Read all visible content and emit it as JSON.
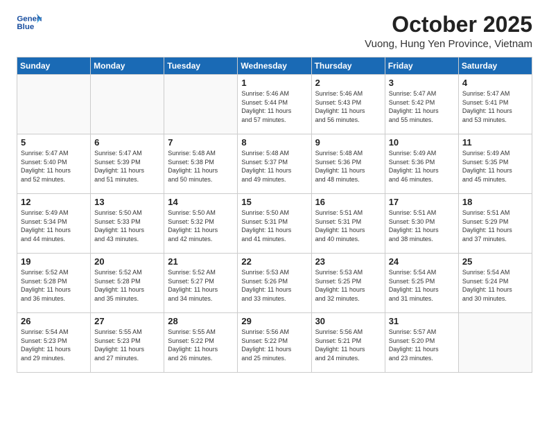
{
  "header": {
    "logo_line1": "General",
    "logo_line2": "Blue",
    "month_title": "October 2025",
    "subtitle": "Vuong, Hung Yen Province, Vietnam"
  },
  "weekdays": [
    "Sunday",
    "Monday",
    "Tuesday",
    "Wednesday",
    "Thursday",
    "Friday",
    "Saturday"
  ],
  "weeks": [
    [
      {
        "day": "",
        "info": ""
      },
      {
        "day": "",
        "info": ""
      },
      {
        "day": "",
        "info": ""
      },
      {
        "day": "1",
        "info": "Sunrise: 5:46 AM\nSunset: 5:44 PM\nDaylight: 11 hours\nand 57 minutes."
      },
      {
        "day": "2",
        "info": "Sunrise: 5:46 AM\nSunset: 5:43 PM\nDaylight: 11 hours\nand 56 minutes."
      },
      {
        "day": "3",
        "info": "Sunrise: 5:47 AM\nSunset: 5:42 PM\nDaylight: 11 hours\nand 55 minutes."
      },
      {
        "day": "4",
        "info": "Sunrise: 5:47 AM\nSunset: 5:41 PM\nDaylight: 11 hours\nand 53 minutes."
      }
    ],
    [
      {
        "day": "5",
        "info": "Sunrise: 5:47 AM\nSunset: 5:40 PM\nDaylight: 11 hours\nand 52 minutes."
      },
      {
        "day": "6",
        "info": "Sunrise: 5:47 AM\nSunset: 5:39 PM\nDaylight: 11 hours\nand 51 minutes."
      },
      {
        "day": "7",
        "info": "Sunrise: 5:48 AM\nSunset: 5:38 PM\nDaylight: 11 hours\nand 50 minutes."
      },
      {
        "day": "8",
        "info": "Sunrise: 5:48 AM\nSunset: 5:37 PM\nDaylight: 11 hours\nand 49 minutes."
      },
      {
        "day": "9",
        "info": "Sunrise: 5:48 AM\nSunset: 5:36 PM\nDaylight: 11 hours\nand 48 minutes."
      },
      {
        "day": "10",
        "info": "Sunrise: 5:49 AM\nSunset: 5:36 PM\nDaylight: 11 hours\nand 46 minutes."
      },
      {
        "day": "11",
        "info": "Sunrise: 5:49 AM\nSunset: 5:35 PM\nDaylight: 11 hours\nand 45 minutes."
      }
    ],
    [
      {
        "day": "12",
        "info": "Sunrise: 5:49 AM\nSunset: 5:34 PM\nDaylight: 11 hours\nand 44 minutes."
      },
      {
        "day": "13",
        "info": "Sunrise: 5:50 AM\nSunset: 5:33 PM\nDaylight: 11 hours\nand 43 minutes."
      },
      {
        "day": "14",
        "info": "Sunrise: 5:50 AM\nSunset: 5:32 PM\nDaylight: 11 hours\nand 42 minutes."
      },
      {
        "day": "15",
        "info": "Sunrise: 5:50 AM\nSunset: 5:31 PM\nDaylight: 11 hours\nand 41 minutes."
      },
      {
        "day": "16",
        "info": "Sunrise: 5:51 AM\nSunset: 5:31 PM\nDaylight: 11 hours\nand 40 minutes."
      },
      {
        "day": "17",
        "info": "Sunrise: 5:51 AM\nSunset: 5:30 PM\nDaylight: 11 hours\nand 38 minutes."
      },
      {
        "day": "18",
        "info": "Sunrise: 5:51 AM\nSunset: 5:29 PM\nDaylight: 11 hours\nand 37 minutes."
      }
    ],
    [
      {
        "day": "19",
        "info": "Sunrise: 5:52 AM\nSunset: 5:28 PM\nDaylight: 11 hours\nand 36 minutes."
      },
      {
        "day": "20",
        "info": "Sunrise: 5:52 AM\nSunset: 5:28 PM\nDaylight: 11 hours\nand 35 minutes."
      },
      {
        "day": "21",
        "info": "Sunrise: 5:52 AM\nSunset: 5:27 PM\nDaylight: 11 hours\nand 34 minutes."
      },
      {
        "day": "22",
        "info": "Sunrise: 5:53 AM\nSunset: 5:26 PM\nDaylight: 11 hours\nand 33 minutes."
      },
      {
        "day": "23",
        "info": "Sunrise: 5:53 AM\nSunset: 5:25 PM\nDaylight: 11 hours\nand 32 minutes."
      },
      {
        "day": "24",
        "info": "Sunrise: 5:54 AM\nSunset: 5:25 PM\nDaylight: 11 hours\nand 31 minutes."
      },
      {
        "day": "25",
        "info": "Sunrise: 5:54 AM\nSunset: 5:24 PM\nDaylight: 11 hours\nand 30 minutes."
      }
    ],
    [
      {
        "day": "26",
        "info": "Sunrise: 5:54 AM\nSunset: 5:23 PM\nDaylight: 11 hours\nand 29 minutes."
      },
      {
        "day": "27",
        "info": "Sunrise: 5:55 AM\nSunset: 5:23 PM\nDaylight: 11 hours\nand 27 minutes."
      },
      {
        "day": "28",
        "info": "Sunrise: 5:55 AM\nSunset: 5:22 PM\nDaylight: 11 hours\nand 26 minutes."
      },
      {
        "day": "29",
        "info": "Sunrise: 5:56 AM\nSunset: 5:22 PM\nDaylight: 11 hours\nand 25 minutes."
      },
      {
        "day": "30",
        "info": "Sunrise: 5:56 AM\nSunset: 5:21 PM\nDaylight: 11 hours\nand 24 minutes."
      },
      {
        "day": "31",
        "info": "Sunrise: 5:57 AM\nSunset: 5:20 PM\nDaylight: 11 hours\nand 23 minutes."
      },
      {
        "day": "",
        "info": ""
      }
    ]
  ]
}
